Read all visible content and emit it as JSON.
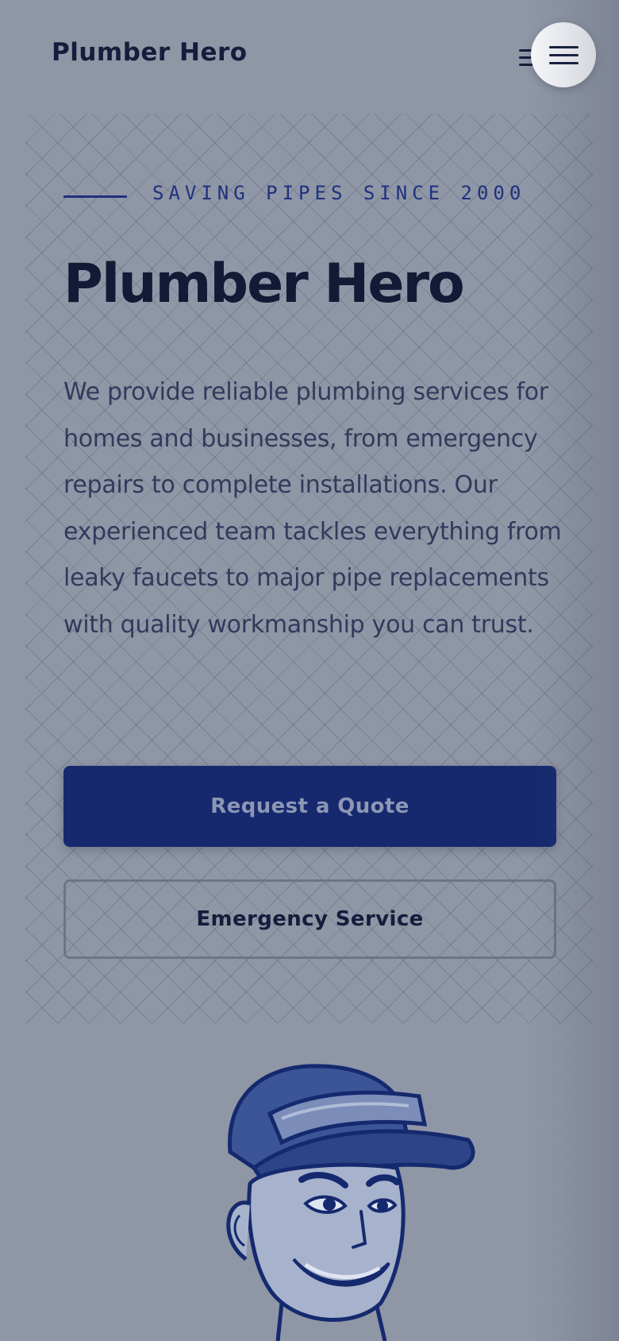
{
  "header": {
    "logo_text": "Plumber Hero",
    "menu_button_icon": "hamburger-icon"
  },
  "hero": {
    "tagline": "SAVING PIPES SINCE 2000",
    "title": "Plumber Hero",
    "description": "We provide reliable plumbing services for homes and businesses, from emergency repairs to complete installations. Our experienced team tackles everything from leaky faucets to major pipe replacements with quality workmanship you can trust.",
    "primary_button_label": "Request a Quote",
    "secondary_button_label": "Emergency Service",
    "illustration_icon": "plumber-mascot-illustration"
  },
  "colors": {
    "background": "#8f96a5",
    "accent": "#16296f",
    "heading": "#121a36",
    "body_text": "#313a5c",
    "menu_button_bg": "#f5f6fa"
  }
}
